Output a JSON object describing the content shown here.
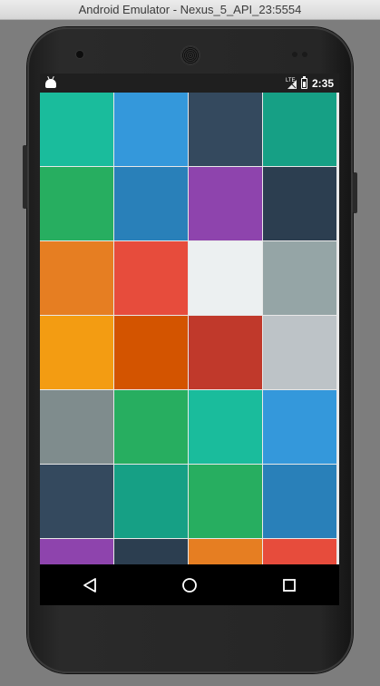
{
  "window": {
    "title": "Android Emulator - Nexus_5_API_23:5554"
  },
  "status_bar": {
    "notification_icon": "android-icon",
    "network_label": "LTE",
    "signal_icon": "signal-icon",
    "battery_icon": "battery-icon",
    "time": "2:35"
  },
  "tiles": [
    "#1abc9c",
    "#3498db",
    "#34495e",
    "#16a085",
    "#27ae60",
    "#2980b9",
    "#8e44ad",
    "#2c3e50",
    "#e67e22",
    "#e74c3c",
    "#ecf0f1",
    "#95a5a6",
    "#f39c12",
    "#d35400",
    "#c0392b",
    "#bdc3c7",
    "#7f8c8d",
    "#27ae60",
    "#1abc9c",
    "#3498db",
    "#34495e",
    "#16a085",
    "#27ae60",
    "#2980b9",
    "#8e44ad",
    "#2c3e50",
    "#e67e22",
    "#e74c3c"
  ],
  "nav_bar": {
    "back_icon": "back-triangle-icon",
    "home_icon": "home-circle-icon",
    "recents_icon": "recents-square-icon"
  }
}
